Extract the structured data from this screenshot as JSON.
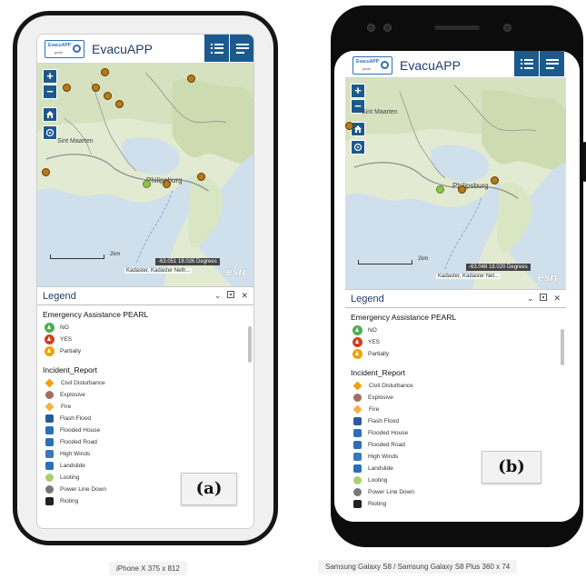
{
  "app": {
    "title": "EvacuAPP",
    "logo_text": "EvacuAPP",
    "logo_sub": "pearl"
  },
  "map": {
    "places": [
      "Sint Maarten",
      "Philipsburg"
    ],
    "scale_label": "2km",
    "coords_a": "-63.051 18.026 Degrees",
    "coords_b": "-63.048 18.020 Degrees",
    "attribution_a": "Kadaster, Kadaster Neth...",
    "attribution_b": "Kadaster, Kadaster Net...",
    "esri": "esri"
  },
  "legend": {
    "title": "Legend",
    "layer1_title": "Emergency Assistance PEARL",
    "layer1_items": [
      {
        "label": "NO",
        "color": "#4caf50"
      },
      {
        "label": "YES",
        "color": "#d2401e"
      },
      {
        "label": "Partially",
        "color": "#f0a20a"
      }
    ],
    "layer2_title": "Incident_Report",
    "layer2_items": [
      {
        "label": "Civil Disturbance",
        "icon": "diamond-orange-icon",
        "color": "#f0a20a"
      },
      {
        "label": "Explosive",
        "icon": "explosive-icon",
        "color": "#a07060"
      },
      {
        "label": "Fire",
        "icon": "fire-diamond-icon",
        "color": "#f4b040"
      },
      {
        "label": "Flash Flood",
        "icon": "flash-flood-icon",
        "color": "#2c5aa0"
      },
      {
        "label": "Flooded House",
        "icon": "flooded-house-icon",
        "color": "#2c6fb7"
      },
      {
        "label": "Flooded Road",
        "icon": "flooded-road-icon",
        "color": "#2c6fb7"
      },
      {
        "label": "High Winds",
        "icon": "flag-icon",
        "color": "#3a78c0"
      },
      {
        "label": "Landslide",
        "icon": "landslide-icon",
        "color": "#2c6fb7"
      },
      {
        "label": "Looting",
        "icon": "looting-icon",
        "color": "#a8d070"
      },
      {
        "label": "Power Line Down",
        "icon": "power-line-icon",
        "color": "#777777"
      },
      {
        "label": "Rioting",
        "icon": "rioting-icon",
        "color": "#222222"
      }
    ]
  },
  "captions": {
    "a": "(a)",
    "b": "(b)"
  },
  "devices": {
    "a": "iPhone X 375 x 812",
    "b": "Samsung Galaxy S8 / Samsung Galaxy S8 Plus 360 x 74"
  }
}
